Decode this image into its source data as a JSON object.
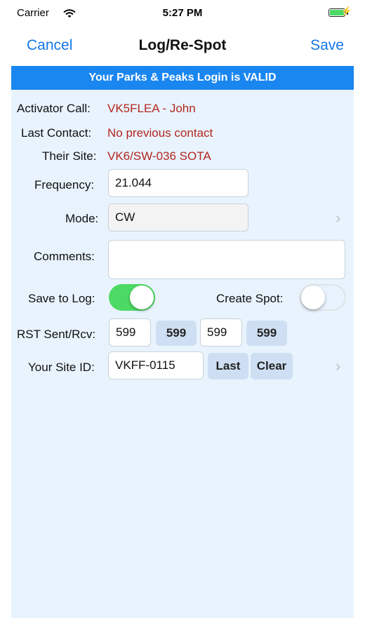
{
  "status_bar": {
    "carrier": "Carrier",
    "time": "5:27 PM"
  },
  "nav": {
    "cancel": "Cancel",
    "title": "Log/Re-Spot",
    "save": "Save"
  },
  "banner": "Your Parks & Peaks Login is VALID",
  "info": {
    "activator_label": "Activator Call:",
    "activator_value": "VK5FLEA - John",
    "last_contact_label": "Last Contact:",
    "last_contact_value": "No previous contact",
    "their_site_label": "Their Site:",
    "their_site_value": "VK6/SW-036  SOTA"
  },
  "form": {
    "frequency_label": "Frequency:",
    "frequency_value": "21.044",
    "mode_label": "Mode:",
    "mode_value": "CW",
    "comments_label": "Comments:",
    "comments_value": "",
    "save_to_log_label": "Save to Log:",
    "save_to_log_on": true,
    "create_spot_label": "Create Spot:",
    "create_spot_on": false,
    "rst_label": "RST Sent/Rcv:",
    "rst_sent_field": "599",
    "rst_sent_button": "599",
    "rst_rcv_field": "599",
    "rst_rcv_button": "599",
    "site_id_label": "Your Site ID:",
    "site_id_value": "VKFF-0115",
    "last_button": "Last",
    "clear_button": "Clear"
  },
  "colors": {
    "accent": "#1476e6",
    "banner": "#1a86f0",
    "red_text": "#b3261e",
    "toggle_on": "#4cd964",
    "background": "#e8f3fd"
  }
}
